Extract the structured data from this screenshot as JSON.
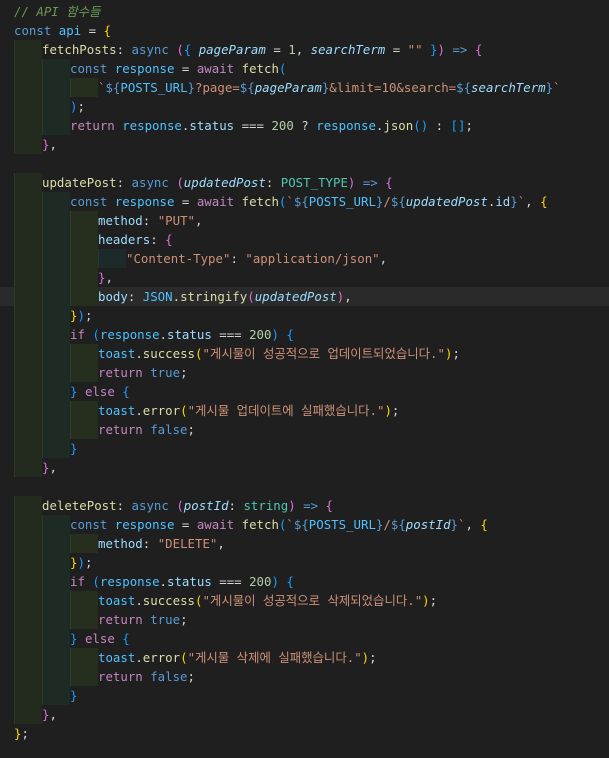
{
  "lines": [
    {
      "indent": 0,
      "tokens": [
        {
          "t": "// API 함수들",
          "c": "c"
        }
      ]
    },
    {
      "indent": 0,
      "tokens": [
        {
          "t": "const ",
          "c": "k"
        },
        {
          "t": "api",
          "c": "ct"
        },
        {
          "t": " = ",
          "c": "o"
        },
        {
          "t": "{",
          "c": "b1"
        }
      ]
    },
    {
      "indent": 1,
      "tokens": [
        {
          "t": "fetchPosts",
          "c": "fn"
        },
        {
          "t": ": ",
          "c": "o"
        },
        {
          "t": "async",
          "c": "k"
        },
        {
          "t": " ",
          "c": "o"
        },
        {
          "t": "(",
          "c": "b2"
        },
        {
          "t": "{",
          "c": "b3"
        },
        {
          "t": " ",
          "c": "o"
        },
        {
          "t": "pageParam",
          "c": "p"
        },
        {
          "t": " = ",
          "c": "o"
        },
        {
          "t": "1",
          "c": "n"
        },
        {
          "t": ", ",
          "c": "o"
        },
        {
          "t": "searchTerm",
          "c": "p"
        },
        {
          "t": " = ",
          "c": "o"
        },
        {
          "t": "\"\"",
          "c": "s"
        },
        {
          "t": " ",
          "c": "o"
        },
        {
          "t": "}",
          "c": "b3"
        },
        {
          "t": ")",
          "c": "b2"
        },
        {
          "t": " => ",
          "c": "k"
        },
        {
          "t": "{",
          "c": "b2"
        }
      ]
    },
    {
      "indent": 2,
      "tokens": [
        {
          "t": "const ",
          "c": "k"
        },
        {
          "t": "response",
          "c": "ct"
        },
        {
          "t": " = ",
          "c": "o"
        },
        {
          "t": "await ",
          "c": "ctl"
        },
        {
          "t": "fetch",
          "c": "f"
        },
        {
          "t": "(",
          "c": "b3"
        }
      ]
    },
    {
      "indent": 3,
      "tokens": [
        {
          "t": "`",
          "c": "s"
        },
        {
          "t": "${",
          "c": "pl"
        },
        {
          "t": "POSTS_URL",
          "c": "ct"
        },
        {
          "t": "}",
          "c": "pl"
        },
        {
          "t": "?page=",
          "c": "s"
        },
        {
          "t": "${",
          "c": "pl"
        },
        {
          "t": "pageParam",
          "c": "p"
        },
        {
          "t": "}",
          "c": "pl"
        },
        {
          "t": "&limit=10&search=",
          "c": "s"
        },
        {
          "t": "${",
          "c": "pl"
        },
        {
          "t": "searchTerm",
          "c": "p"
        },
        {
          "t": "}",
          "c": "pl"
        },
        {
          "t": "`",
          "c": "s"
        }
      ]
    },
    {
      "indent": 2,
      "tokens": [
        {
          "t": ")",
          "c": "b3"
        },
        {
          "t": ";",
          "c": "o"
        }
      ]
    },
    {
      "indent": 2,
      "tokens": [
        {
          "t": "return ",
          "c": "ctl"
        },
        {
          "t": "response",
          "c": "ct"
        },
        {
          "t": ".",
          "c": "o"
        },
        {
          "t": "status",
          "c": "pr"
        },
        {
          "t": " === ",
          "c": "o"
        },
        {
          "t": "200",
          "c": "n"
        },
        {
          "t": " ? ",
          "c": "o"
        },
        {
          "t": "response",
          "c": "ct"
        },
        {
          "t": ".",
          "c": "o"
        },
        {
          "t": "json",
          "c": "f"
        },
        {
          "t": "()",
          "c": "b3"
        },
        {
          "t": " : ",
          "c": "o"
        },
        {
          "t": "[]",
          "c": "b3"
        },
        {
          "t": ";",
          "c": "o"
        }
      ]
    },
    {
      "indent": 1,
      "tokens": [
        {
          "t": "}",
          "c": "b2"
        },
        {
          "t": ",",
          "c": "o"
        }
      ]
    },
    {
      "indent": 1,
      "tokens": []
    },
    {
      "indent": 1,
      "tokens": [
        {
          "t": "updatePost",
          "c": "fn"
        },
        {
          "t": ": ",
          "c": "o"
        },
        {
          "t": "async",
          "c": "k"
        },
        {
          "t": " ",
          "c": "o"
        },
        {
          "t": "(",
          "c": "b2"
        },
        {
          "t": "updatedPost",
          "c": "p"
        },
        {
          "t": ": ",
          "c": "o"
        },
        {
          "t": "POST_TYPE",
          "c": "t"
        },
        {
          "t": ")",
          "c": "b2"
        },
        {
          "t": " => ",
          "c": "k"
        },
        {
          "t": "{",
          "c": "b2"
        }
      ]
    },
    {
      "indent": 2,
      "tokens": [
        {
          "t": "const ",
          "c": "k"
        },
        {
          "t": "response",
          "c": "ct"
        },
        {
          "t": " = ",
          "c": "o"
        },
        {
          "t": "await ",
          "c": "ctl"
        },
        {
          "t": "fetch",
          "c": "f"
        },
        {
          "t": "(",
          "c": "b3"
        },
        {
          "t": "`",
          "c": "s"
        },
        {
          "t": "${",
          "c": "pl"
        },
        {
          "t": "POSTS_URL",
          "c": "ct"
        },
        {
          "t": "}",
          "c": "pl"
        },
        {
          "t": "/",
          "c": "s"
        },
        {
          "t": "${",
          "c": "pl"
        },
        {
          "t": "updatedPost",
          "c": "p"
        },
        {
          "t": ".",
          "c": "o"
        },
        {
          "t": "id",
          "c": "pr"
        },
        {
          "t": "}",
          "c": "pl"
        },
        {
          "t": "`",
          "c": "s"
        },
        {
          "t": ", ",
          "c": "o"
        },
        {
          "t": "{",
          "c": "b1"
        }
      ]
    },
    {
      "indent": 3,
      "tokens": [
        {
          "t": "method",
          "c": "pr"
        },
        {
          "t": ": ",
          "c": "o"
        },
        {
          "t": "\"PUT\"",
          "c": "s"
        },
        {
          "t": ",",
          "c": "o"
        }
      ]
    },
    {
      "indent": 3,
      "tokens": [
        {
          "t": "headers",
          "c": "pr"
        },
        {
          "t": ": ",
          "c": "o"
        },
        {
          "t": "{",
          "c": "b2"
        }
      ]
    },
    {
      "indent": 4,
      "tokens": [
        {
          "t": "\"Content-Type\"",
          "c": "s"
        },
        {
          "t": ": ",
          "c": "o"
        },
        {
          "t": "\"application/json\"",
          "c": "s"
        },
        {
          "t": ",",
          "c": "o"
        }
      ]
    },
    {
      "indent": 3,
      "tokens": [
        {
          "t": "}",
          "c": "b2"
        },
        {
          "t": ",",
          "c": "o"
        }
      ]
    },
    {
      "indent": 3,
      "hl": true,
      "tokens": [
        {
          "t": "body",
          "c": "pr"
        },
        {
          "t": ": ",
          "c": "o"
        },
        {
          "t": "JSON",
          "c": "ct"
        },
        {
          "t": ".",
          "c": "o"
        },
        {
          "t": "stringify",
          "c": "f"
        },
        {
          "t": "(",
          "c": "b2"
        },
        {
          "t": "updatedPost",
          "c": "p"
        },
        {
          "t": ")",
          "c": "b2"
        },
        {
          "t": ",",
          "c": "o"
        }
      ]
    },
    {
      "indent": 2,
      "tokens": [
        {
          "t": "}",
          "c": "b1"
        },
        {
          "t": ")",
          "c": "b3"
        },
        {
          "t": ";",
          "c": "o"
        }
      ]
    },
    {
      "indent": 2,
      "tokens": [
        {
          "t": "if ",
          "c": "ctl"
        },
        {
          "t": "(",
          "c": "b3"
        },
        {
          "t": "response",
          "c": "ct"
        },
        {
          "t": ".",
          "c": "o"
        },
        {
          "t": "status",
          "c": "pr"
        },
        {
          "t": " === ",
          "c": "o"
        },
        {
          "t": "200",
          "c": "n"
        },
        {
          "t": ")",
          "c": "b3"
        },
        {
          "t": " ",
          "c": "o"
        },
        {
          "t": "{",
          "c": "b3"
        }
      ]
    },
    {
      "indent": 3,
      "tokens": [
        {
          "t": "toast",
          "c": "ct"
        },
        {
          "t": ".",
          "c": "o"
        },
        {
          "t": "success",
          "c": "f"
        },
        {
          "t": "(",
          "c": "b1"
        },
        {
          "t": "\"게시물이 성공적으로 업데이트되었습니다.\"",
          "c": "s"
        },
        {
          "t": ")",
          "c": "b1"
        },
        {
          "t": ";",
          "c": "o"
        }
      ]
    },
    {
      "indent": 3,
      "tokens": [
        {
          "t": "return ",
          "c": "ctl"
        },
        {
          "t": "true",
          "c": "k"
        },
        {
          "t": ";",
          "c": "o"
        }
      ]
    },
    {
      "indent": 2,
      "tokens": [
        {
          "t": "}",
          "c": "b3"
        },
        {
          "t": " ",
          "c": "o"
        },
        {
          "t": "else",
          "c": "ctl"
        },
        {
          "t": " ",
          "c": "o"
        },
        {
          "t": "{",
          "c": "b3"
        }
      ]
    },
    {
      "indent": 3,
      "tokens": [
        {
          "t": "toast",
          "c": "ct"
        },
        {
          "t": ".",
          "c": "o"
        },
        {
          "t": "error",
          "c": "f"
        },
        {
          "t": "(",
          "c": "b1"
        },
        {
          "t": "\"게시물 업데이트에 실패했습니다.\"",
          "c": "s"
        },
        {
          "t": ")",
          "c": "b1"
        },
        {
          "t": ";",
          "c": "o"
        }
      ]
    },
    {
      "indent": 3,
      "tokens": [
        {
          "t": "return ",
          "c": "ctl"
        },
        {
          "t": "false",
          "c": "k"
        },
        {
          "t": ";",
          "c": "o"
        }
      ]
    },
    {
      "indent": 2,
      "tokens": [
        {
          "t": "}",
          "c": "b3"
        }
      ]
    },
    {
      "indent": 1,
      "tokens": [
        {
          "t": "}",
          "c": "b2"
        },
        {
          "t": ",",
          "c": "o"
        }
      ]
    },
    {
      "indent": 1,
      "tokens": []
    },
    {
      "indent": 1,
      "tokens": [
        {
          "t": "deletePost",
          "c": "fn"
        },
        {
          "t": ": ",
          "c": "o"
        },
        {
          "t": "async",
          "c": "k"
        },
        {
          "t": " ",
          "c": "o"
        },
        {
          "t": "(",
          "c": "b2"
        },
        {
          "t": "postId",
          "c": "p"
        },
        {
          "t": ": ",
          "c": "o"
        },
        {
          "t": "string",
          "c": "t"
        },
        {
          "t": ")",
          "c": "b2"
        },
        {
          "t": " => ",
          "c": "k"
        },
        {
          "t": "{",
          "c": "b2"
        }
      ]
    },
    {
      "indent": 2,
      "tokens": [
        {
          "t": "const ",
          "c": "k"
        },
        {
          "t": "response",
          "c": "ct"
        },
        {
          "t": " = ",
          "c": "o"
        },
        {
          "t": "await ",
          "c": "ctl"
        },
        {
          "t": "fetch",
          "c": "f"
        },
        {
          "t": "(",
          "c": "b3"
        },
        {
          "t": "`",
          "c": "s"
        },
        {
          "t": "${",
          "c": "pl"
        },
        {
          "t": "POSTS_URL",
          "c": "ct"
        },
        {
          "t": "}",
          "c": "pl"
        },
        {
          "t": "/",
          "c": "s"
        },
        {
          "t": "${",
          "c": "pl"
        },
        {
          "t": "postId",
          "c": "p"
        },
        {
          "t": "}",
          "c": "pl"
        },
        {
          "t": "`",
          "c": "s"
        },
        {
          "t": ", ",
          "c": "o"
        },
        {
          "t": "{",
          "c": "b1"
        }
      ]
    },
    {
      "indent": 3,
      "tokens": [
        {
          "t": "method",
          "c": "pr"
        },
        {
          "t": ": ",
          "c": "o"
        },
        {
          "t": "\"DELETE\"",
          "c": "s"
        },
        {
          "t": ",",
          "c": "o"
        }
      ]
    },
    {
      "indent": 2,
      "tokens": [
        {
          "t": "}",
          "c": "b1"
        },
        {
          "t": ")",
          "c": "b3"
        },
        {
          "t": ";",
          "c": "o"
        }
      ]
    },
    {
      "indent": 2,
      "tokens": [
        {
          "t": "if ",
          "c": "ctl"
        },
        {
          "t": "(",
          "c": "b3"
        },
        {
          "t": "response",
          "c": "ct"
        },
        {
          "t": ".",
          "c": "o"
        },
        {
          "t": "status",
          "c": "pr"
        },
        {
          "t": " === ",
          "c": "o"
        },
        {
          "t": "200",
          "c": "n"
        },
        {
          "t": ")",
          "c": "b3"
        },
        {
          "t": " ",
          "c": "o"
        },
        {
          "t": "{",
          "c": "b3"
        }
      ]
    },
    {
      "indent": 3,
      "tokens": [
        {
          "t": "toast",
          "c": "ct"
        },
        {
          "t": ".",
          "c": "o"
        },
        {
          "t": "success",
          "c": "f"
        },
        {
          "t": "(",
          "c": "b1"
        },
        {
          "t": "\"게시물이 성공적으로 삭제되었습니다.\"",
          "c": "s"
        },
        {
          "t": ")",
          "c": "b1"
        },
        {
          "t": ";",
          "c": "o"
        }
      ]
    },
    {
      "indent": 3,
      "tokens": [
        {
          "t": "return ",
          "c": "ctl"
        },
        {
          "t": "true",
          "c": "k"
        },
        {
          "t": ";",
          "c": "o"
        }
      ]
    },
    {
      "indent": 2,
      "tokens": [
        {
          "t": "}",
          "c": "b3"
        },
        {
          "t": " ",
          "c": "o"
        },
        {
          "t": "else",
          "c": "ctl"
        },
        {
          "t": " ",
          "c": "o"
        },
        {
          "t": "{",
          "c": "b3"
        }
      ]
    },
    {
      "indent": 3,
      "tokens": [
        {
          "t": "toast",
          "c": "ct"
        },
        {
          "t": ".",
          "c": "o"
        },
        {
          "t": "error",
          "c": "f"
        },
        {
          "t": "(",
          "c": "b1"
        },
        {
          "t": "\"게시물 삭제에 실패했습니다.\"",
          "c": "s"
        },
        {
          "t": ")",
          "c": "b1"
        },
        {
          "t": ";",
          "c": "o"
        }
      ]
    },
    {
      "indent": 3,
      "tokens": [
        {
          "t": "return ",
          "c": "ctl"
        },
        {
          "t": "false",
          "c": "k"
        },
        {
          "t": ";",
          "c": "o"
        }
      ]
    },
    {
      "indent": 2,
      "tokens": [
        {
          "t": "}",
          "c": "b3"
        }
      ]
    },
    {
      "indent": 1,
      "tokens": [
        {
          "t": "}",
          "c": "b2"
        },
        {
          "t": ",",
          "c": "o"
        }
      ]
    },
    {
      "indent": 0,
      "tokens": [
        {
          "t": "}",
          "c": "b1"
        },
        {
          "t": ";",
          "c": "o"
        }
      ]
    }
  ]
}
